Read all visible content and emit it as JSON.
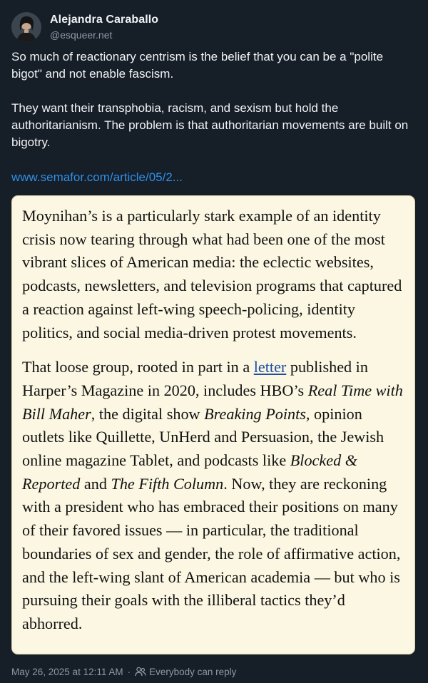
{
  "author": {
    "display_name": "Alejandra Caraballo",
    "handle": "@esqueer.net"
  },
  "post": {
    "paragraphs": [
      "So much of reactionary centrism is the belief that you can be a \"polite bigot\" and not enable fascism.",
      "They want their transphobia, racism, and sexism but hold the authoritarianism. The problem is that authoritarian movements are built on bigotry."
    ],
    "link_text": "www.semafor.com/article/05/2..."
  },
  "quote": {
    "p1": "Moynihan’s is a particularly stark example of an identity crisis now tearing through what had been one of the most vibrant slices of American media: the eclectic websites, podcasts, newsletters, and television programs that captured a reaction against left-wing speech-policing, identity politics, and social media-driven protest movements.",
    "p2": {
      "s1": "That loose group, rooted in part in a ",
      "link": "letter",
      "s2": " published in Harper’s Magazine in 2020, includes HBO’s ",
      "i1": "Real Time with Bill Maher",
      "s3": ", the digital show ",
      "i2": "Breaking Points,",
      "s4": " opinion outlets like Quillette, UnHerd and Persuasion, the Jewish online magazine Tablet, and podcasts like ",
      "i3": "Blocked & Reported",
      "s5": " and ",
      "i4": "The Fifth Column",
      "s6": ". Now, they are reckoning with a president who has embraced their positions on many of their favored issues — in particular, the traditional boundaries of sex and gender, the role of affirmative action, and the left-wing slant of American academia — but who is pursuing their goals with the illiberal tactics they’d abhorred."
    }
  },
  "footer": {
    "timestamp": "May 26, 2025 at 12:11 AM",
    "separator": "·",
    "reply_icon": "people-icon",
    "reply_setting": "Everybody can reply"
  },
  "colors": {
    "background": "#161e27",
    "link": "#2f8fe8",
    "quote_bg": "#fbf7e2",
    "muted": "#8d9aa8"
  }
}
